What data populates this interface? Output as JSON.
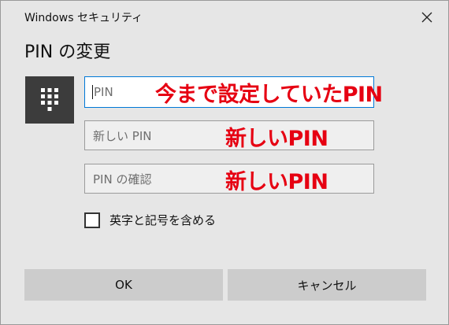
{
  "window": {
    "title": "Windows セキュリティ",
    "heading": "PIN の変更"
  },
  "fields": {
    "current_pin_placeholder": "PIN",
    "new_pin_placeholder": "新しい PIN",
    "confirm_pin_placeholder": "PIN の確認"
  },
  "annotations": {
    "current": "今まで設定していたPIN",
    "new": "新しいPIN",
    "confirm": "新しいPIN"
  },
  "checkbox": {
    "label": "英字と記号を含める",
    "checked": false
  },
  "buttons": {
    "ok": "OK",
    "cancel": "キャンセル"
  },
  "icons": {
    "close": "close-icon",
    "pin_pad": "pin-pad-icon"
  },
  "colors": {
    "annotation": "#e60012",
    "focus_border": "#0078d7",
    "icon_bg": "#3c3c3c",
    "dialog_bg": "#e6e6e6"
  }
}
